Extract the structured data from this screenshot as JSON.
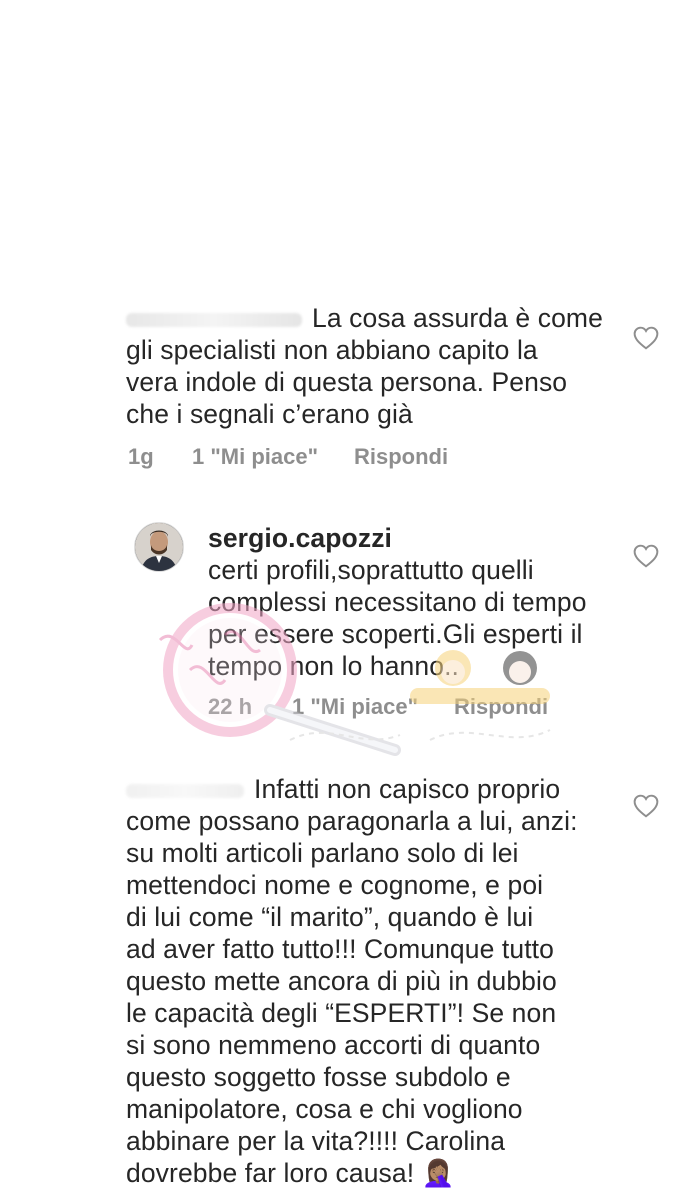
{
  "comments": [
    {
      "username": "",
      "text": "La cosa assurda è come\ngli specialisti non abbiano capito la\nvera indole di questa persona. Penso\nche i segnali c’erano già",
      "time": "1g",
      "likes": "1 \"Mi piace\"",
      "reply": "Rispondi",
      "icon": "heart-outline-icon"
    },
    {
      "username": "sergio.capozzi",
      "text": "certi profili,soprattutto quelli\ncomplessi necessitano di tempo\nper essere scoperti.Gli esperti il\ntempo non lo hanno..",
      "time": "22 h",
      "likes": "1 \"Mi piace\"",
      "reply": "Rispondi",
      "icon": "heart-outline-icon"
    },
    {
      "username": "",
      "text": "Infatti non capisco proprio\ncome possano paragonarla a lui, anzi:\nsu molti articoli parlano solo di lei\nmettendoci nome e cognome, e poi\ndi lui come “il marito”, quando è lui\nad aver fatto tutto!!! Comunque tutto\nquesto mette ancora di più in dubbio\nle capacità degli “ESPERTI”! Se non\nsi sono nemmeno accorti di quanto\nquesto soggetto fosse subdolo e\nmanipolatore, cosa e chi vogliono\nabbinare per la vita?!!!! Carolina\ndovrebbe far loro causa! 🤦🏽‍♀️",
      "icon": "heart-outline-icon"
    }
  ],
  "colors": {
    "text": "#262626",
    "meta": "#8e8e8e",
    "icon": "#8e8e8e"
  }
}
